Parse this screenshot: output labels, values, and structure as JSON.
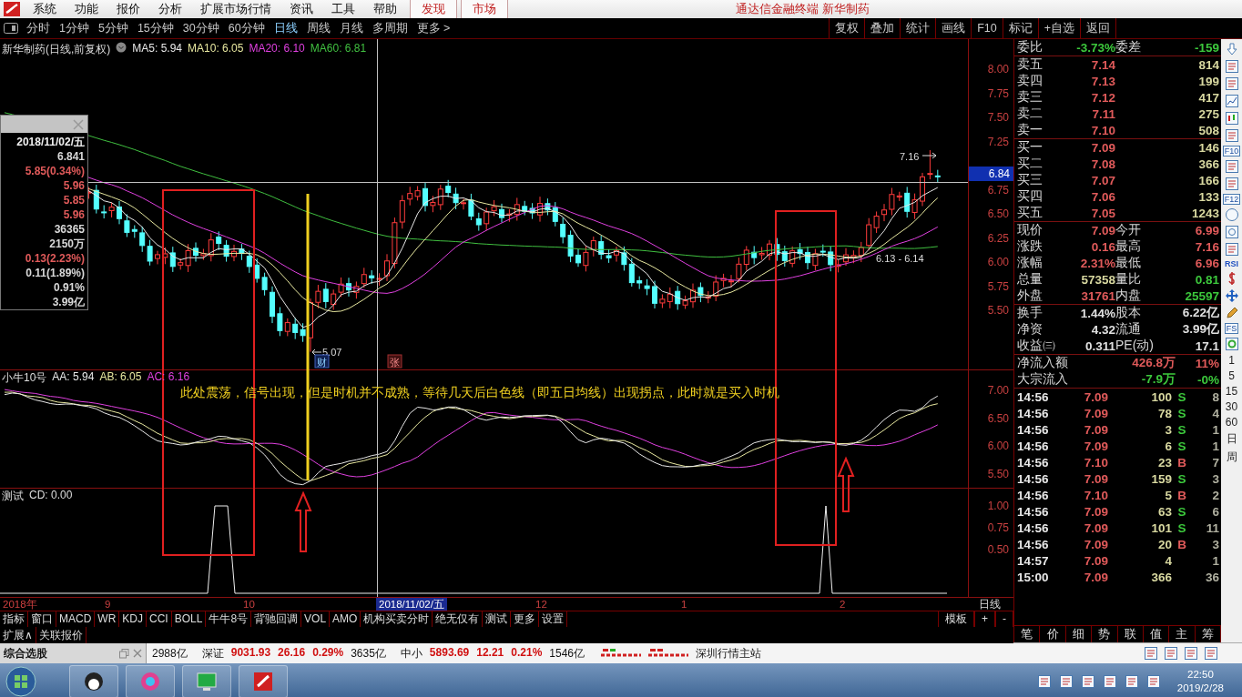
{
  "menu_bar": {
    "items": [
      "系统",
      "功能",
      "报价",
      "分析",
      "扩展市场行情",
      "资讯",
      "工具",
      "帮助"
    ],
    "highlighted_items": [
      "发现",
      "市场"
    ],
    "title": "通达信金融终端 新华制药"
  },
  "toolbar": {
    "periods": [
      {
        "label": "分时",
        "selected": false
      },
      {
        "label": "1分钟",
        "selected": false
      },
      {
        "label": "5分钟",
        "selected": false
      },
      {
        "label": "15分钟",
        "selected": false
      },
      {
        "label": "30分钟",
        "selected": false
      },
      {
        "label": "60分钟",
        "selected": false
      },
      {
        "label": "日线",
        "selected": true
      },
      {
        "label": "周线",
        "selected": false
      },
      {
        "label": "月线",
        "selected": false
      },
      {
        "label": "多周期",
        "selected": false
      },
      {
        "label": "更多 >",
        "selected": false
      }
    ],
    "buttons": [
      "复权",
      "叠加",
      "统计",
      "画线",
      "F10",
      "标记",
      "+自选",
      "返回"
    ]
  },
  "chart": {
    "title": "新华制药(日线,前复权)",
    "moving_averages": [
      {
        "label": "MA5: 5.94",
        "color": "#e8e8e8"
      },
      {
        "label": "MA10: 6.05",
        "color": "#e8e8a0"
      },
      {
        "label": "MA20: 6.10",
        "color": "#e040e0"
      },
      {
        "label": "MA60: 6.81",
        "color": "#40c040"
      }
    ],
    "price_axis": [
      "8.00",
      "7.75",
      "7.50",
      "7.25",
      "6.75",
      "6.50",
      "6.25",
      "6.00",
      "5.75",
      "5.50"
    ],
    "crosshair_price": "6.84",
    "info_panel": [
      {
        "text": "2018/11/02/五",
        "color": "#f0f0f0"
      },
      {
        "text": "6.841",
        "color": "#d8d8d8"
      },
      {
        "text": "5.85(0.34%)",
        "color": "#e05a5a"
      },
      {
        "text": "5.96",
        "color": "#e05a5a"
      },
      {
        "text": "5.85",
        "color": "#e05a5a"
      },
      {
        "text": "5.96",
        "color": "#e05a5a"
      },
      {
        "text": "36365",
        "color": "#d8d8d8"
      },
      {
        "text": "2150万",
        "color": "#d8d8d8"
      },
      {
        "text": "0.13(2.23%)",
        "color": "#e05a5a"
      },
      {
        "text": "0.11(1.89%)",
        "color": "#d8d8d8"
      },
      {
        "text": "0.91%",
        "color": "#d8d8d8"
      },
      {
        "text": "3.99亿",
        "color": "#d8d8d8"
      }
    ],
    "markers": {
      "high_label": "7.16",
      "low_label": "5.07",
      "finance_tag": "财",
      "rise_tag": "张",
      "range_label": "6.13 - 6.14"
    },
    "annotation": "此处震荡，信号出现，但是时机并不成熟，等待几天后白色线（即五日均线）出现拐点，此时就是买入时机",
    "indicator_panel": {
      "title": "小牛10号",
      "values": [
        {
          "label": "AA: 5.94",
          "color": "#e8e8e8"
        },
        {
          "label": "AB: 6.05",
          "color": "#e8e8a0"
        },
        {
          "label": "AC: 6.16",
          "color": "#e040e0"
        }
      ],
      "axis": [
        "7.00",
        "6.50",
        "6.00",
        "5.50"
      ]
    },
    "test_panel": {
      "title": "测试",
      "value": "CD: 0.00",
      "axis": [
        "1.00",
        "0.75",
        "0.50"
      ]
    },
    "time_axis": [
      {
        "label": "2018年",
        "kind": "year"
      },
      {
        "label": "9",
        "kind": "month"
      },
      {
        "label": "10",
        "kind": "month"
      },
      {
        "label": "2018/11/02/五",
        "kind": "cursor"
      },
      {
        "label": "12",
        "kind": "month"
      },
      {
        "label": "1",
        "kind": "month"
      },
      {
        "label": "2",
        "kind": "month"
      }
    ],
    "period_label": "日线"
  },
  "indicator_tabs": [
    "指标",
    "窗口",
    "MACD",
    "WR",
    "KDJ",
    "CCI",
    "BOLL",
    "牛牛8号",
    "背驰回调",
    "VOL",
    "AMO",
    "机构买卖分时",
    "绝无仅有",
    "测试",
    "更多",
    "设置"
  ],
  "template_buttons": [
    "模板",
    "+",
    "-"
  ],
  "extension_tabs": [
    "扩展∧",
    "关联报价"
  ],
  "quote": {
    "order_ratio": {
      "label": "委比",
      "value": "-3.73%",
      "label2": "委差",
      "value2": "-159"
    },
    "asks": [
      {
        "label": "卖五",
        "price": "7.14",
        "volume": "814"
      },
      {
        "label": "卖四",
        "price": "7.13",
        "volume": "199"
      },
      {
        "label": "卖三",
        "price": "7.12",
        "volume": "417"
      },
      {
        "label": "卖二",
        "price": "7.11",
        "volume": "275"
      },
      {
        "label": "卖一",
        "price": "7.10",
        "volume": "508"
      }
    ],
    "bids": [
      {
        "label": "买一",
        "price": "7.09",
        "volume": "146"
      },
      {
        "label": "买二",
        "price": "7.08",
        "volume": "366"
      },
      {
        "label": "买三",
        "price": "7.07",
        "volume": "166"
      },
      {
        "label": "买四",
        "price": "7.06",
        "volume": "133"
      },
      {
        "label": "买五",
        "price": "7.05",
        "volume": "1243"
      }
    ],
    "stats": [
      [
        {
          "label": "现价",
          "value": "7.09",
          "color": "#e05a5a"
        },
        {
          "label": "今开",
          "value": "6.99",
          "color": "#e05a5a"
        }
      ],
      [
        {
          "label": "涨跌",
          "value": "0.16",
          "color": "#e05a5a"
        },
        {
          "label": "最高",
          "value": "7.16",
          "color": "#e05a5a"
        }
      ],
      [
        {
          "label": "涨幅",
          "value": "2.31%",
          "color": "#e05a5a"
        },
        {
          "label": "最低",
          "value": "6.96",
          "color": "#e05a5a"
        }
      ],
      [
        {
          "label": "总量",
          "value": "57358",
          "color": "#d8d8a0"
        },
        {
          "label": "量比",
          "value": "0.81",
          "color": "#3cc83c"
        }
      ],
      [
        {
          "label": "外盘",
          "value": "31761",
          "color": "#e05a5a"
        },
        {
          "label": "内盘",
          "value": "25597",
          "color": "#3cc83c"
        }
      ]
    ],
    "fundamentals": [
      [
        {
          "label": "换手",
          "value": "1.44%"
        },
        {
          "label": "股本",
          "value": "6.22亿"
        }
      ],
      [
        {
          "label": "净资",
          "value": "4.32"
        },
        {
          "label": "流通",
          "value": "3.99亿"
        }
      ],
      [
        {
          "label": "收益㈢",
          "value": "0.311"
        },
        {
          "label": "PE(动)",
          "value": "17.1"
        }
      ]
    ],
    "flows": [
      {
        "label": "净流入额",
        "value": "426.8万",
        "percent": "11%",
        "color": "#e05a5a"
      },
      {
        "label": "大宗流入",
        "value": "-7.9万",
        "percent": "-0%",
        "color": "#3cc83c"
      }
    ],
    "trades": [
      {
        "time": "14:56",
        "price": "7.09",
        "volume": "100",
        "side": "S",
        "color": "#3cc83c",
        "count": "8"
      },
      {
        "time": "14:56",
        "price": "7.09",
        "volume": "78",
        "side": "S",
        "color": "#3cc83c",
        "count": "4"
      },
      {
        "time": "14:56",
        "price": "7.09",
        "volume": "3",
        "side": "S",
        "color": "#3cc83c",
        "count": "1"
      },
      {
        "time": "14:56",
        "price": "7.09",
        "volume": "6",
        "side": "S",
        "color": "#3cc83c",
        "count": "1"
      },
      {
        "time": "14:56",
        "price": "7.10",
        "volume": "23",
        "side": "B",
        "color": "#e05a5a",
        "count": "7"
      },
      {
        "time": "14:56",
        "price": "7.09",
        "volume": "159",
        "side": "S",
        "color": "#3cc83c",
        "count": "3"
      },
      {
        "time": "14:56",
        "price": "7.10",
        "volume": "5",
        "side": "B",
        "color": "#e05a5a",
        "count": "2"
      },
      {
        "time": "14:56",
        "price": "7.09",
        "volume": "63",
        "side": "S",
        "color": "#3cc83c",
        "count": "6"
      },
      {
        "time": "14:56",
        "price": "7.09",
        "volume": "101",
        "side": "S",
        "color": "#3cc83c",
        "count": "11"
      },
      {
        "time": "14:56",
        "price": "7.09",
        "volume": "20",
        "side": "B",
        "color": "#e05a5a",
        "count": "3"
      },
      {
        "time": "14:57",
        "price": "7.09",
        "volume": "4",
        "count": "1"
      },
      {
        "time": "15:00",
        "price": "7.09",
        "volume": "366",
        "count": "36"
      }
    ],
    "tabs": [
      "笔",
      "价",
      "细",
      "势",
      "联",
      "值",
      "主",
      "筹"
    ]
  },
  "side_strip": {
    "tool_labels": [
      "F10",
      "F12",
      "RSI",
      "FS"
    ],
    "periods": [
      "1",
      "5",
      "15",
      "30",
      "60",
      "日",
      "周"
    ]
  },
  "status_bar": {
    "selector_title": "综合选股",
    "indices": [
      {
        "amount": "2988亿"
      },
      {
        "name": "深证",
        "value": "9031.93",
        "change": "26.16",
        "percent": "0.29%",
        "amount": "3635亿"
      },
      {
        "name": "中小",
        "value": "5893.69",
        "change": "12.21",
        "percent": "0.21%",
        "amount": "1546亿"
      }
    ],
    "server": "深圳行情主站"
  },
  "taskbar": {
    "time": "22:50",
    "date": "2019/2/28"
  }
}
